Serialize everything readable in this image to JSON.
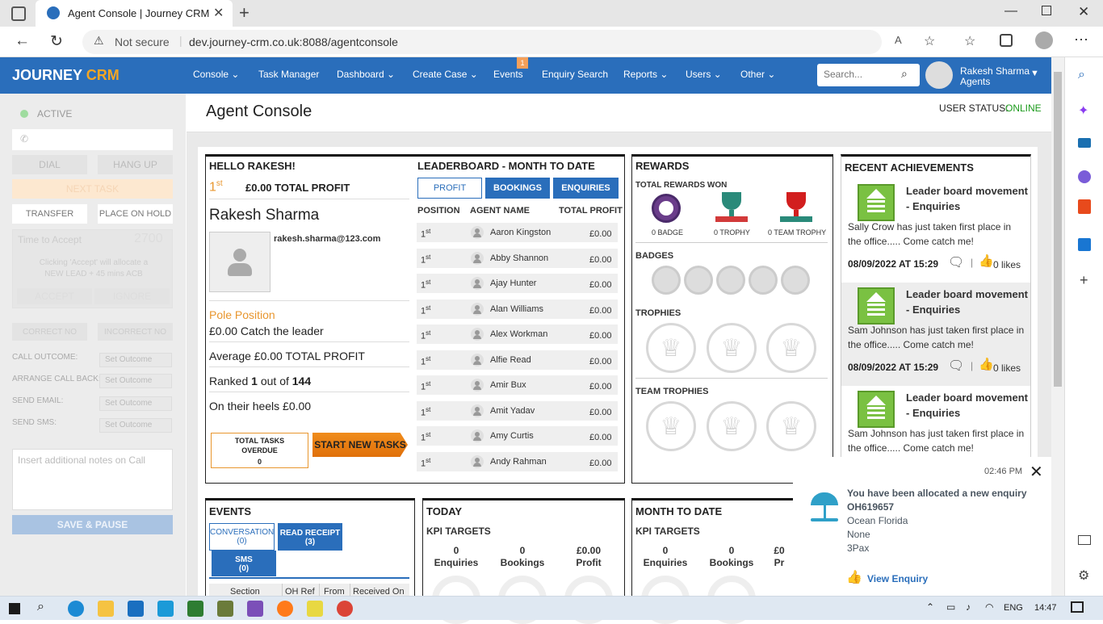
{
  "browser": {
    "tab_title": "Agent Console | Journey CRM",
    "not_secure": "Not secure",
    "url": "dev.journey-crm.co.uk:8088/agentconsole"
  },
  "nav": {
    "logo_a": "JOURNEY",
    "logo_b": "CRM",
    "items": [
      "Console",
      "Task Manager",
      "Dashboard",
      "Create Case",
      "Events",
      "Enquiry Search",
      "Reports",
      "Users",
      "Other"
    ],
    "events_badge": "1",
    "search_placeholder": "Search...",
    "user_name": "Rakesh Sharma",
    "user_role": "Agents"
  },
  "left": {
    "status": "ACTIVE",
    "dial": "DIAL",
    "hang_up": "HANG UP",
    "next_task": "NEXT TASK",
    "transfer": "TRANSFER",
    "place_on_hold": "PLACE ON HOLD",
    "time_to_accept": "Time to Accept",
    "timer": "2700",
    "accept_note": "Clicking 'Accept' will allocate a NEW LEAD + 45 mins ACB",
    "accept": "ACCEPT",
    "ignore": "IGNORE",
    "correct_no": "CORRECT NO",
    "incorrect_no": "INCORRECT NO",
    "call_outcome": "CALL OUTCOME:",
    "arrange_call_back": "ARRANGE CALL BACK:",
    "send_email": "SEND EMAIL:",
    "send_sms": "SEND SMS:",
    "set_outcome": "Set Outcome",
    "notes_placeholder": "Insert additional notes on Call",
    "save_pause": "SAVE & PAUSE"
  },
  "header": {
    "title": "Agent Console",
    "user_status_label": "USER STATUS:",
    "user_status_value": "ONLINE"
  },
  "hello": {
    "title": "HELLO RAKESH!",
    "rank_num": "1",
    "rank_sup": "st",
    "total_profit": "£0.00 TOTAL PROFIT",
    "name": "Rakesh Sharma",
    "email": "rakesh.sharma@123.com",
    "pole": "Pole Position",
    "catch": "£0.00 Catch the leader",
    "average": "Average £0.00 TOTAL PROFIT",
    "ranked_a": "Ranked ",
    "ranked_b": "1",
    "ranked_c": " out of ",
    "ranked_d": "144",
    "heels": "On their heels £0.00",
    "tasks_overdue": "TOTAL TASKS OVERDUE",
    "tasks_count": "0",
    "start_new": "START NEW TASKS"
  },
  "leaderboard": {
    "title": "LEADERBOARD - MONTH TO DATE",
    "tabs": [
      "PROFIT",
      "BOOKINGS",
      "ENQUIRIES"
    ],
    "col_position": "POSITION",
    "col_agent": "AGENT NAME",
    "col_profit": "TOTAL PROFIT",
    "rows": [
      {
        "pos": "1",
        "sup": "st",
        "name": "Aaron Kingston",
        "profit": "£0.00"
      },
      {
        "pos": "1",
        "sup": "st",
        "name": "Abby Shannon",
        "profit": "£0.00"
      },
      {
        "pos": "1",
        "sup": "st",
        "name": "Ajay Hunter",
        "profit": "£0.00"
      },
      {
        "pos": "1",
        "sup": "st",
        "name": "Alan Williams",
        "profit": "£0.00"
      },
      {
        "pos": "1",
        "sup": "st",
        "name": "Alex Workman",
        "profit": "£0.00"
      },
      {
        "pos": "1",
        "sup": "st",
        "name": "Alfie Read",
        "profit": "£0.00"
      },
      {
        "pos": "1",
        "sup": "st",
        "name": "Amir Bux",
        "profit": "£0.00"
      },
      {
        "pos": "1",
        "sup": "st",
        "name": "Amit Yadav",
        "profit": "£0.00"
      },
      {
        "pos": "1",
        "sup": "st",
        "name": "Amy Curtis",
        "profit": "£0.00"
      },
      {
        "pos": "1",
        "sup": "st",
        "name": "Andy Rahman",
        "profit": "£0.00"
      }
    ]
  },
  "rewards": {
    "title": "REWARDS",
    "total_won": "TOTAL REWARDS WON",
    "badge": "0 BADGE",
    "trophy": "0 TROPHY",
    "team_trophy": "0 TEAM TROPHY",
    "badges": "BADGES",
    "trophies": "TROPHIES",
    "team_trophies": "TEAM TROPHIES"
  },
  "achievements": {
    "title": "RECENT ACHIEVEMENTS",
    "items": [
      {
        "title_a": "Leader board movement",
        "title_b": "- Enquiries",
        "text_a": "Sally Crow has just taken first place in",
        "text_b": "the office..... Come catch me!",
        "date": "08/09/2022 AT 15:29",
        "likes": "0 likes"
      },
      {
        "title_a": "Leader board movement",
        "title_b": "- Enquiries",
        "text_a": "Sam Johnson has just taken first place in",
        "text_b": "the office..... Come catch me!",
        "date": "08/09/2022 AT 15:29",
        "likes": "0 likes"
      },
      {
        "title_a": "Leader board movement",
        "title_b": "- Enquiries",
        "text_a": "Sam Johnson has just taken first place in",
        "text_b": "the office..... Come catch me!",
        "date": "",
        "likes": ""
      }
    ]
  },
  "events": {
    "title": "EVENTS",
    "conversation": "CONVERSATION",
    "conversation_count": "(0)",
    "read_receipt": "READ RECEIPT",
    "read_receipt_count": "(3)",
    "sms": "SMS",
    "sms_count": "(0)",
    "cols": [
      "Section",
      "OH Ref",
      "From",
      "Received On"
    ]
  },
  "today": {
    "title": "TODAY",
    "kpi": "KPI TARGETS",
    "enq_val": "0",
    "enq": "Enquiries",
    "book_val": "0",
    "book": "Bookings",
    "profit_val": "£0.00",
    "profit": "Profit"
  },
  "mtd": {
    "title": "MONTH TO DATE",
    "kpi": "KPI TARGETS",
    "enq_val": "0",
    "enq": "Enquiries",
    "book_val": "0",
    "book": "Bookings",
    "profit_val": "£0",
    "profit": "Pr"
  },
  "toast": {
    "time": "02:46 PM",
    "line1": "You have been allocated a new enquiry",
    "ref": "OH619657",
    "dest": "Ocean Florida",
    "board": "None",
    "pax": "3Pax",
    "link": "View Enquiry"
  },
  "taskbar": {
    "lang": "ENG",
    "time": "14:47"
  },
  "colors": {
    "brand": "#2a6ebb",
    "accent_orange": "#e8962e",
    "online_green": "#1a9a1a"
  }
}
